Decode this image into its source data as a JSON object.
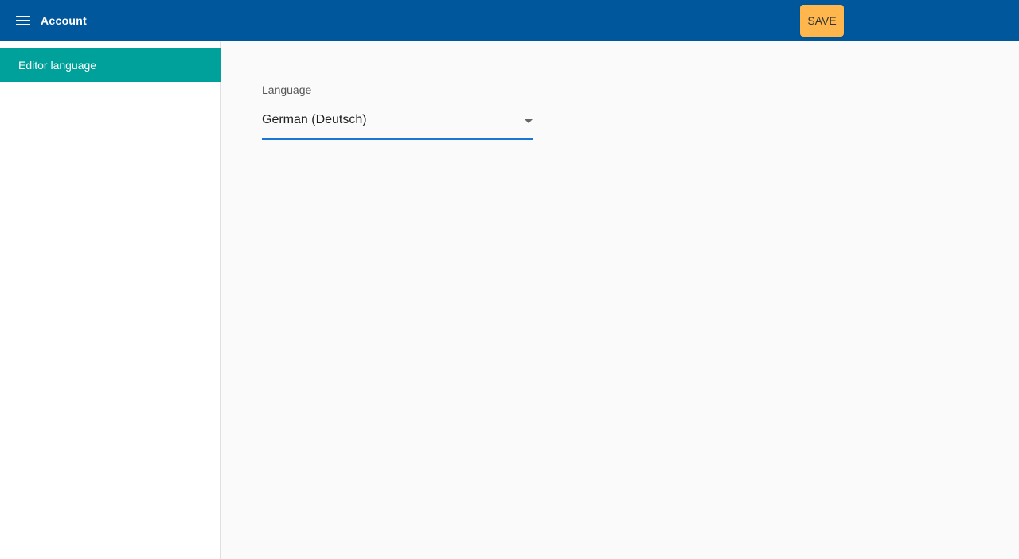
{
  "header": {
    "title": "Account",
    "menu_icon": "menu-icon",
    "save_label": "SAVE"
  },
  "sidebar": {
    "items": [
      {
        "label": "Editor language",
        "active": true
      }
    ]
  },
  "main": {
    "language_field": {
      "label": "Language",
      "value": "German (Deutsch)",
      "dropdown_icon": "arrow-drop-down-icon"
    }
  },
  "colors": {
    "header_bg": "#01579b",
    "save_button_bg": "#ffb74d",
    "sidebar_active_bg": "#00a19a",
    "field_underline": "#1976d2"
  }
}
